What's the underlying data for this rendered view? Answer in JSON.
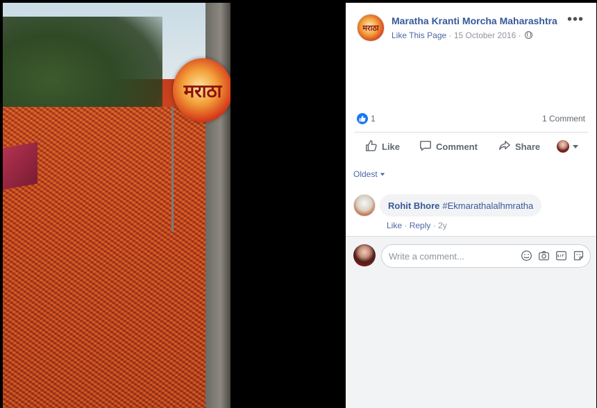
{
  "photo": {
    "logo_text": "मराठा"
  },
  "post": {
    "page_name": "Maratha Kranti Morcha Maharashtra",
    "like_page": "Like This Page",
    "separator": "·",
    "date": "15 October 2016",
    "more_label": "•••"
  },
  "reactions": {
    "like_count": "1",
    "comment_count": "1 Comment"
  },
  "actions": {
    "like": "Like",
    "comment": "Comment",
    "share": "Share"
  },
  "comments": {
    "sort_label": "Oldest",
    "items": [
      {
        "author": "Rohit Bhore",
        "text": "#Ekmarathalalhmratha",
        "like": "Like",
        "reply": "Reply",
        "age": "2y"
      }
    ]
  },
  "composer": {
    "placeholder": "Write a comment..."
  },
  "colors": {
    "link": "#365899",
    "like_blue": "#1877f2",
    "muted": "#90949c"
  }
}
